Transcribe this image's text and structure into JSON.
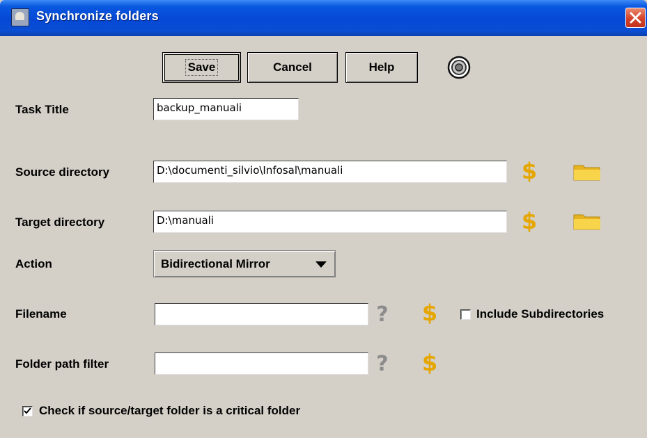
{
  "window": {
    "title": "Synchronize folders",
    "close_icon": "close-icon",
    "app_icon": "app-icon"
  },
  "toolbar": {
    "save_label": "Save",
    "cancel_label": "Cancel",
    "help_label": "Help",
    "extra_icon": "circle-target-icon"
  },
  "form": {
    "task_title": {
      "label": "Task Title",
      "value": "backup_manuali"
    },
    "source_directory": {
      "label": "Source directory",
      "value": "D:\\documenti_silvio\\Infosal\\manuali"
    },
    "target_directory": {
      "label": "Target directory",
      "value": "D:\\manuali"
    },
    "action": {
      "label": "Action",
      "value": "Bidirectional Mirror"
    },
    "filename": {
      "label": "Filename",
      "value": ""
    },
    "include_subdirectories": {
      "label": "Include Subdirectories",
      "checked": false
    },
    "folder_path_filter": {
      "label": "Folder path filter",
      "value": ""
    },
    "critical_folder": {
      "label": "Check if source/target folder is a critical folder",
      "checked": true
    }
  },
  "colors": {
    "titlebar": "#0548d6",
    "window_bg": "#d4d0c8",
    "dollar_gold": "#e5a600",
    "folder_yellow": "#f2c633",
    "help_gray": "#8c8c8c"
  }
}
